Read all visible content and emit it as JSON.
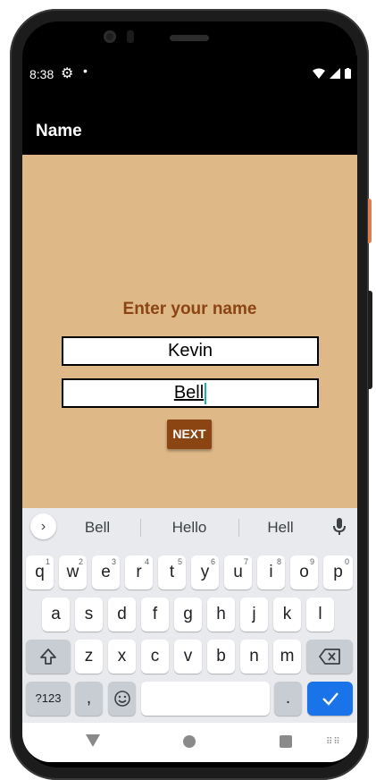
{
  "status_bar": {
    "time": "8:38",
    "gear_icon": "gear-icon",
    "dot": "•"
  },
  "app_bar": {
    "title": "Name"
  },
  "form": {
    "prompt": "Enter your name",
    "first_name_value": "Kevin",
    "last_name_value": "Bell",
    "next_label": "NEXT"
  },
  "keyboard": {
    "suggestions": [
      "Bell",
      "Hello",
      "Hell"
    ],
    "row1": [
      "q",
      "w",
      "e",
      "r",
      "t",
      "y",
      "u",
      "i",
      "o",
      "p"
    ],
    "row1_hints": [
      "1",
      "2",
      "3",
      "4",
      "5",
      "6",
      "7",
      "8",
      "9",
      "0"
    ],
    "row2": [
      "a",
      "s",
      "d",
      "f",
      "g",
      "h",
      "j",
      "k",
      "l"
    ],
    "row3": [
      "z",
      "x",
      "c",
      "v",
      "b",
      "n",
      "m"
    ],
    "symbols_label": "?123",
    "comma": ",",
    "period": "."
  },
  "colors": {
    "background": "#deb887",
    "accent": "#8b4513",
    "enter": "#1a73e8"
  }
}
